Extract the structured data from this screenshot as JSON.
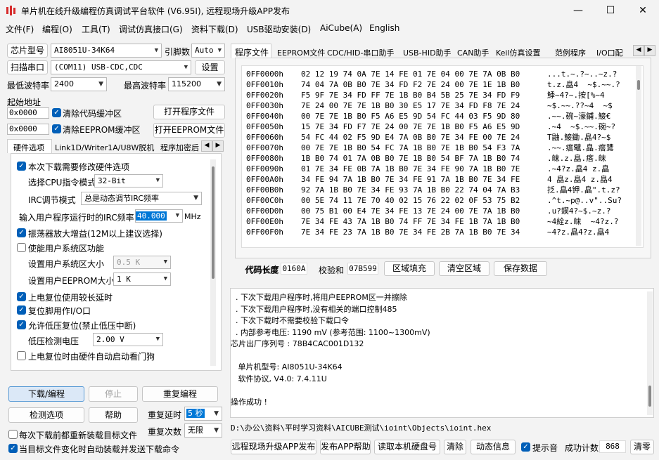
{
  "window": {
    "title": "单片机在线升级编程仿真调试平台软件 (V6.95I), 远程现场升级APP发布",
    "minimize": "—",
    "maximize": "☐",
    "close": "✕"
  },
  "menu": [
    "文件(F)",
    "编程(O)",
    "工具(T)",
    "调试仿真接口(G)",
    "资料下载(D)",
    "USB驱动安装(D)",
    "AiCube(A)",
    "English"
  ],
  "left": {
    "chip_label": "芯片型号",
    "chip_value": "AI8051U-34K64",
    "pin_label": "引脚数",
    "pin_value": "Auto",
    "scan_button": "扫描串口",
    "port_value": "(COM11) USB-CDC,CDC",
    "settings_button": "设置",
    "min_baud_label": "最低波特率",
    "min_baud_value": "2400",
    "max_baud_label": "最高波特率",
    "max_baud_value": "115200",
    "start_addr_label": "起始地址",
    "addr1": "0x0000",
    "clear_code_label": "清除代码缓冲区",
    "open_program": "打开程序文件",
    "addr2": "0x0000",
    "clear_eeprom_label": "清除EEPROM缓冲区",
    "open_eeprom": "打开EEPROM文件",
    "tabs": [
      "硬件选项",
      "Link1D/Writer1A/U8W脱机",
      "程序加密后"
    ],
    "hw": {
      "opt_modify": "本次下载需要修改硬件选项",
      "cpu_label": "选择CPU指令模式",
      "cpu_value": "32-Bit",
      "irc_mode_label": "IRC调节模式",
      "irc_mode_value": "总是动态调节IRC频率",
      "irc_freq_label": "输入用户程序运行时的IRC频率",
      "irc_freq_value": "40.000",
      "irc_unit": "MHz",
      "osc_gain": "振荡器放大增益(12M以上建议选择)",
      "user_sys": "使能用户系统区功能",
      "user_sys_size_label": "设置用户系统区大小",
      "user_sys_size_value": "0.5 K",
      "eeprom_size_label": "设置用户EEPROM大小",
      "eeprom_size_value": "1  K",
      "power_delay": "上电复位使用较长延时",
      "reset_io": "复位脚用作I/O口",
      "lvr": "允许低压复位(禁止低压中断)",
      "lvd_label": "低压检测电压",
      "lvd_value": "2.00 V",
      "watchdog": "上电复位时由硬件自动启动看门狗"
    },
    "download_button": "下载/编程",
    "stop_button": "停止",
    "reprogram_button": "重复编程",
    "detect_button": "检测选项",
    "help_button": "帮助",
    "repeat_delay_label": "重复延时",
    "repeat_delay_value": "5 秒",
    "repeat_count_label": "重复次数",
    "repeat_count_value": "无限",
    "reload_label": "每次下载前都重新装载目标文件",
    "auto_send_label": "当目标文件变化时自动装载并发送下载命令"
  },
  "right": {
    "tabs": [
      "程序文件",
      "EEPROM文件",
      "CDC/HID-串口助手",
      "USB-HID助手",
      "CAN助手",
      "Keil仿真设置",
      "范例程序",
      "I/O口配"
    ],
    "hex_rows": [
      {
        "addr": "0FF0000h",
        "bytes": "02 12 19 74 0A 7E 14 FE 01 7E 04 00 7E 7A 0B B0",
        "ascii": "...t.~.?~..~z.?"
      },
      {
        "addr": "0FF0010h",
        "bytes": "74 04 7A 0B B0 7E 34 FD F2 7E 24 00 7E 1E 1B B0",
        "ascii": "t.z.皛4  ~$.~~.?"
      },
      {
        "addr": "0FF0020h",
        "bytes": "F5 9F 7E 34 FD FF 7E 1B B0 B4 5B 25 7E 34 FD F9",
        "ascii": "鯚~4?~.按[%~4"
      },
      {
        "addr": "0FF0030h",
        "bytes": "7E 24 00 7E 7E 1B B0 30 E5 17 7E 34 FD F8 7E 24",
        "ascii": "~$.~~.??~4  ~$"
      },
      {
        "addr": "0FF0040h",
        "bytes": "00 7E 7E 1B B0 F5 A6 E5 9D 54 FC 44 03 F5 9D 80",
        "ascii": ".~~.碗~濠鋪.鯜€"
      },
      {
        "addr": "0FF0050h",
        "bytes": "15 7E 34 FD F7 7E 24 00 7E 7E 1B B0 F5 A6 E5 9D",
        "ascii": ".~4  ~$.~~.碗~?"
      },
      {
        "addr": "0FF0060h",
        "bytes": "54 FC 44 02 F5 9D E4 7A 0B B0 7E 34 FE 00 7E 24",
        "ascii": "T鼬.鯜鋤.皛4?~$"
      },
      {
        "addr": "0FF0070h",
        "bytes": "00 7E 7E 1B B0 54 FC 7A 1B B0 7E 1B B0 54 F3 7A",
        "ascii": ".~~.瘩鼊.皛.瘩鷕"
      },
      {
        "addr": "0FF0080h",
        "bytes": "1B B0 74 01 7A 0B B0 7E 1B B0 54 BF 7A 1B B0 74",
        "ascii": ".皌.z.皛.瘩.皌"
      },
      {
        "addr": "0FF0090h",
        "bytes": "01 7E 34 FE 0B 7A 1B B0 7E 34 FE 90 7A 1B B0 7E",
        "ascii": ".~4?z.皛4 z.皛"
      },
      {
        "addr": "0FF00A0h",
        "bytes": "34 FE 94 7A 1B B0 7E 34 FE 91 7A 1B B0 7E 34 FE",
        "ascii": "4 皛z.皛4 z.皛4"
      },
      {
        "addr": "0FF00B0h",
        "bytes": "92 7A 1B B0 7E 34 FE 93 7A 1B B0 22 74 04 7A B3",
        "ascii": "抸.皛4钾.皛\".t.z?"
      },
      {
        "addr": "0FF00C0h",
        "bytes": "00 5E 74 11 7E 70 40 02 15 76 22 02 0F 53 75 B2",
        "ascii": ".^t.~p@..v\"..Su?"
      },
      {
        "addr": "0FF00D0h",
        "bytes": "00 75 B1 00 E4 7E 34 FE 13 7E 24 00 7E 7A 1B B0",
        "ascii": ".u?鍥4?~$.~z.?"
      },
      {
        "addr": "0FF00E0h",
        "bytes": "7E 34 FE 43 7A 1B B0 74 FF 7E 34 FE 1B 7A 1B B0",
        "ascii": "~4絟z.皌  ~4?z.?"
      },
      {
        "addr": "0FF00F0h",
        "bytes": "7E 34 FE 23 7A 1B B0 7E 34 FE 2B 7A 1B B0 7E 34",
        "ascii": "~4?z.皛4?z.皛4"
      }
    ],
    "code_len_label": "代码长度",
    "code_len_value": "0160A",
    "checksum_label": "校验和",
    "checksum_value": "07B599",
    "fill_button": "区域填充",
    "clear_button": "清空区域",
    "save_button": "保存数据",
    "log_lines": [
      "  . 下次下载用户程序时,将用户EEPROM区一并擦除",
      "  . 下次下载用户程序时,没有相关的端口控制485",
      "  . 下次下载时不需要校验下载口令",
      "  . 内部参考电压: 1190 mV (参考范围: 1100~1300mV)",
      "芯片出厂序列号 : 78B4CAC001D132",
      "",
      "   单片机型号: AI8051U-34K64",
      "   软件协议, V4.0: 7.4.11U",
      "",
      "操作成功 !"
    ],
    "path": "D:\\办公\\资料\\平时学习资料\\AICUBE测试\\ioint\\Objects\\ioint.hex",
    "btn_remote": "远程现场升级APP发布",
    "btn_publish_help": "发布APP帮助",
    "btn_read_disk": "读取本机硬盘号",
    "btn_clear": "清除",
    "btn_dynamic": "动态信息",
    "beep_label": "提示音",
    "success_label": "成功计数",
    "success_value": "868",
    "btn_reset": "清零"
  }
}
